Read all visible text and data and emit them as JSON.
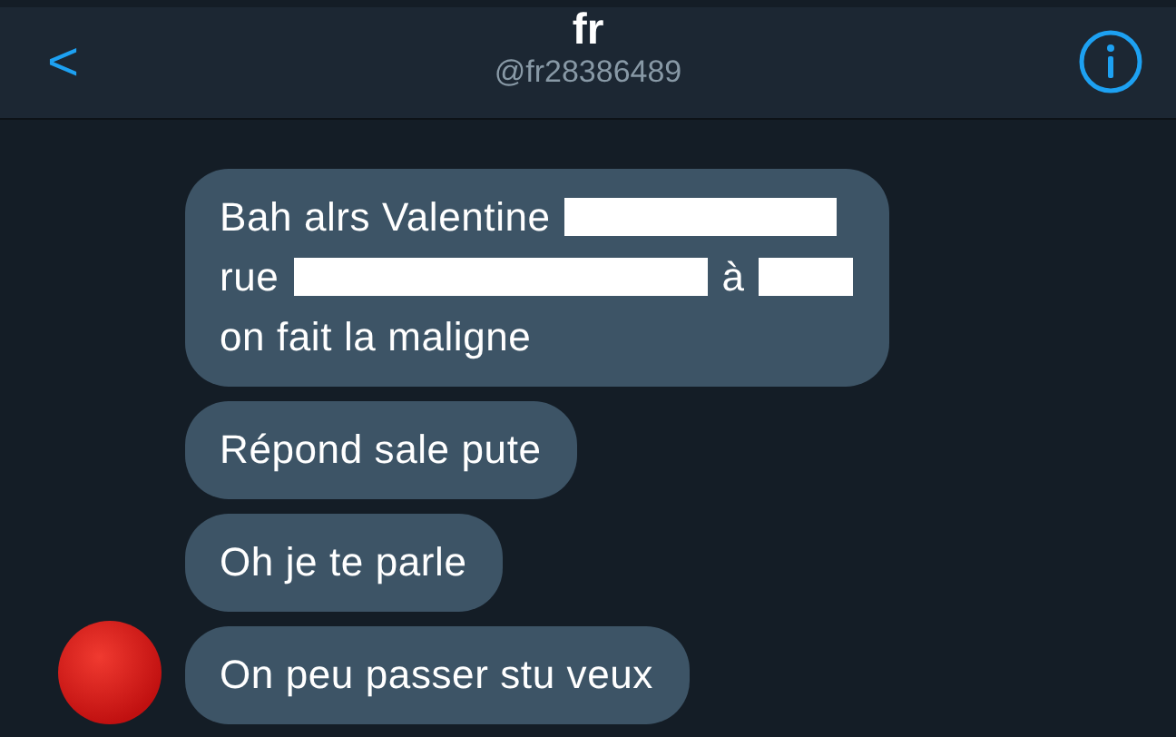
{
  "header": {
    "back": "<",
    "title": "fr",
    "handle": "@fr28386489"
  },
  "messages": [
    {
      "avatar": false,
      "lines": [
        [
          {
            "kind": "text",
            "text": "Bah alrs Valentine"
          },
          {
            "kind": "redaction"
          }
        ],
        [
          {
            "kind": "text",
            "text": "rue"
          },
          {
            "kind": "redaction"
          },
          {
            "kind": "text",
            "text": "à"
          },
          {
            "kind": "redaction"
          }
        ],
        [
          {
            "kind": "text",
            "text": "on fait la maligne"
          }
        ]
      ]
    },
    {
      "avatar": false,
      "lines": [
        [
          {
            "kind": "text",
            "text": "Répond sale pute"
          }
        ]
      ]
    },
    {
      "avatar": false,
      "lines": [
        [
          {
            "kind": "text",
            "text": "Oh je te parle"
          }
        ]
      ]
    },
    {
      "avatar": true,
      "lines": [
        [
          {
            "kind": "text",
            "text": "On peu passer stu veux"
          }
        ]
      ]
    }
  ]
}
